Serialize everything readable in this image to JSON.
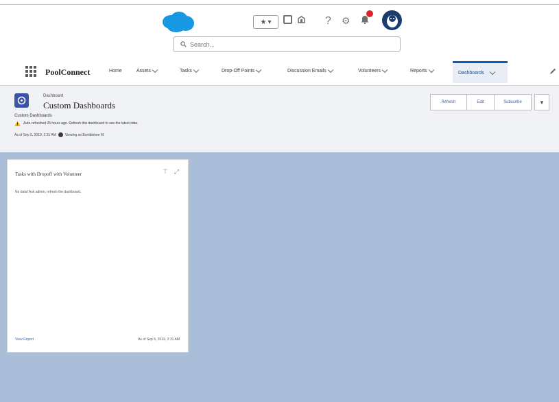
{
  "global_header": {
    "search_placeholder": "Search...",
    "favorites_star": "★",
    "favorites_caret": "▾",
    "help_glyph": "?",
    "settings_glyph": "⚙"
  },
  "colors": {
    "brand_cloud": "#1798e2",
    "nav_active": "#0b5cab",
    "canvas_bg": "#aabed9",
    "dashboard_icon": "#3a54a6",
    "warning": "#e2b21c",
    "notification_badge": "#d8262d"
  },
  "nav": {
    "app_name": "PoolConnect",
    "items": [
      {
        "label": "Home",
        "dropdown": false
      },
      {
        "label": "Assets",
        "dropdown": true
      },
      {
        "label": "Tasks",
        "dropdown": true
      },
      {
        "label": "Drop-Off Points",
        "dropdown": true
      },
      {
        "label": "Discussion Emails",
        "dropdown": true
      },
      {
        "label": "Volunteers",
        "dropdown": true
      },
      {
        "label": "Reports",
        "dropdown": true
      },
      {
        "label": "Dashboards",
        "dropdown": true,
        "active": true
      }
    ]
  },
  "page_header": {
    "object_label": "Dashboard",
    "title": "Custom Dashboards",
    "subtitle": "Custom Dashboards",
    "warning_text": "Auto-refreshed 25 hours ago. Refresh this dashboard to see the latest data.",
    "as_of_text": "As of Sep 5, 2019, 2:31 AM",
    "viewing_as": "Viewing as Bumblebee M.",
    "buttons": [
      "Refresh",
      "Edit",
      "Subscribe"
    ]
  },
  "widget": {
    "title": "Tasks with Dropoff with Volunteer",
    "empty_message": "No data! Ask admin, refresh the dashboard.",
    "footer_link": "View Report",
    "footer_time": "As of Sep 5, 2019, 2:31 AM"
  }
}
